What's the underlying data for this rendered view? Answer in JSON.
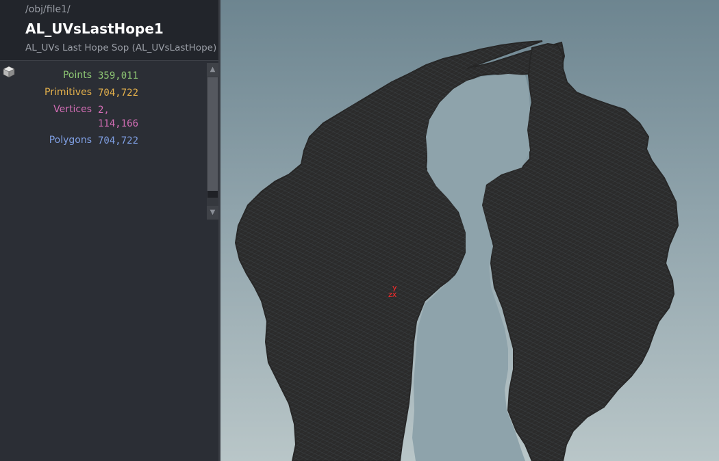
{
  "header": {
    "path": "/obj/file1/",
    "node_name": "AL_UVsLastHope1",
    "node_type": "AL_UVs Last Hope Sop (AL_UVsLastHope)"
  },
  "geometry_icon": "cube-icon",
  "stats": {
    "points_label": "Points",
    "points_value": "359,011",
    "primitives_label": "Primitives",
    "primitives_value": "704,722",
    "vertices_label": "Vertices",
    "vertices_value_line1": "2,",
    "vertices_value_line2": "114,166",
    "polygons_label": "Polygons",
    "polygons_value": "704,722"
  },
  "colors": {
    "points": "#8ec774",
    "primitives": "#e6b24c",
    "vertices": "#d46eb6",
    "polygons": "#7f9fe3",
    "mesh": "#2c2c2c",
    "axis": "#ff2a2a"
  },
  "viewport": {
    "axis_y": "y",
    "axis_zx": "zx"
  }
}
